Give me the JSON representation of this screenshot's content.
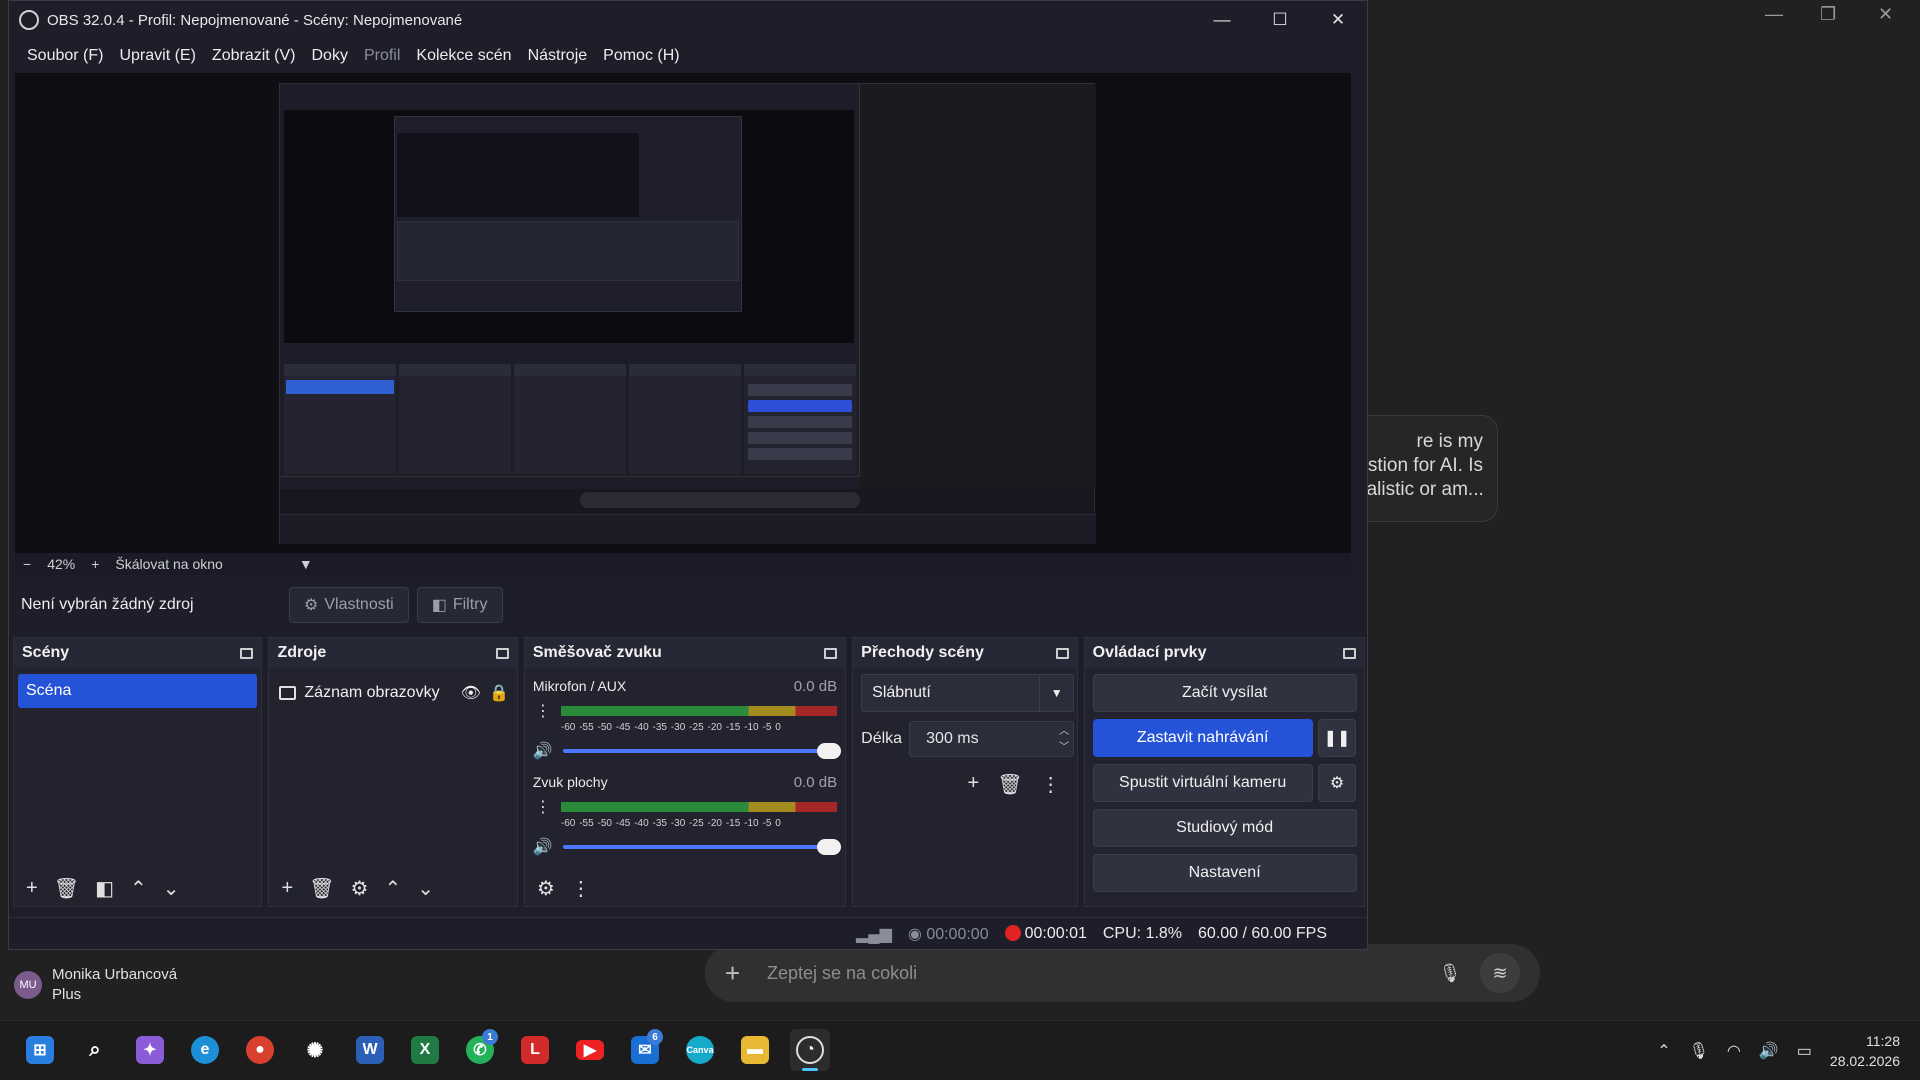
{
  "background": {
    "bubble_lines": [
      "re is my",
      "stion for AI. Is",
      "ealistic or am..."
    ],
    "user": {
      "initials": "MU",
      "name": "Monika Urbancová",
      "plan": "Plus"
    },
    "chat_placeholder": "Zeptej se na cokoli"
  },
  "obs": {
    "title": "OBS 32.0.4 - Profil: Nepojmenované - Scény: Nepojmenované",
    "menu": [
      "Soubor (F)",
      "Upravit (E)",
      "Zobrazit (V)",
      "Doky",
      "Profil",
      "Kolekce scén",
      "Nástroje",
      "Pomoc (H)"
    ],
    "zoom": {
      "minus": "−",
      "value": "42%",
      "plus": "+",
      "scale_mode": "Škálovat na okno"
    },
    "source_bar": {
      "no_source": "Není vybrán žádný zdroj",
      "properties": "Vlastnosti",
      "filters": "Filtry"
    },
    "docks": {
      "scenes": {
        "title": "Scény",
        "items": [
          "Scéna"
        ]
      },
      "sources": {
        "title": "Zdroje",
        "items": [
          "Záznam obrazovky"
        ]
      },
      "mixer": {
        "title": "Směšovač zvuku",
        "channels": [
          {
            "name": "Mikrofon / AUX",
            "db": "0.0 dB",
            "level": 0.0
          },
          {
            "name": "Zvuk plochy",
            "db": "0.0 dB",
            "level": 0.0
          }
        ],
        "ticks": [
          "-60",
          "-55",
          "-50",
          "-45",
          "-40",
          "-35",
          "-30",
          "-25",
          "-20",
          "-15",
          "-10",
          "-5",
          "0"
        ]
      },
      "transitions": {
        "title": "Přechody scény",
        "selected": "Slábnutí",
        "duration_label": "Délka",
        "duration": "300 ms"
      },
      "controls": {
        "title": "Ovládací prvky",
        "start_stream": "Začít vysílat",
        "stop_recording": "Zastavit nahrávání",
        "virtual_cam": "Spustit virtuální kameru",
        "studio_mode": "Studiový mód",
        "settings": "Nastavení"
      }
    },
    "status": {
      "stream_time": "00:00:00",
      "rec_time": "00:00:01",
      "cpu": "CPU: 1.8%",
      "fps": "60.00 / 60.00 FPS"
    }
  },
  "taskbar": {
    "time": "11:28",
    "date": "28.02.2026",
    "badges": {
      "whatsapp": "1",
      "mail": "6"
    }
  },
  "colors": {
    "accent": "#2553d8",
    "record": "#e02424",
    "obs_bg": "#1d1e2a"
  }
}
